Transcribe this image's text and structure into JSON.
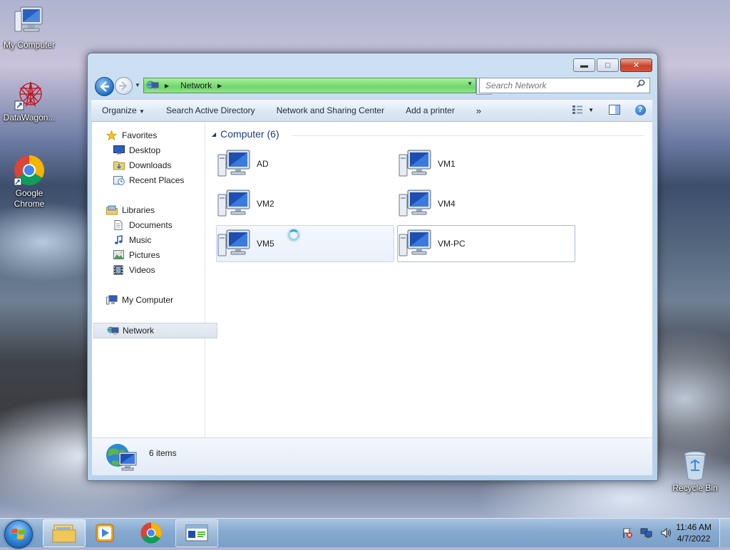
{
  "desktop": {
    "icons": [
      {
        "label": "My Computer"
      },
      {
        "label": "DataWagon..."
      },
      {
        "label": "Google Chrome"
      },
      {
        "label": "Recycle Bin"
      }
    ]
  },
  "window": {
    "address": {
      "location": "Network"
    },
    "search": {
      "placeholder": "Search Network"
    },
    "commands": [
      "Organize",
      "Search Active Directory",
      "Network and Sharing Center",
      "Add a printer"
    ],
    "more": "»",
    "nav": {
      "favorites": "Favorites",
      "desktop": "Desktop",
      "downloads": "Downloads",
      "recent": "Recent Places",
      "libraries": "Libraries",
      "documents": "Documents",
      "music": "Music",
      "pictures": "Pictures",
      "videos": "Videos",
      "computer": "My Computer",
      "network": "Network"
    },
    "group": {
      "title": "Computer (6)"
    },
    "computers": [
      "AD",
      "VM1",
      "VM2",
      "VM4",
      "VM5",
      "VM-PC"
    ],
    "status": {
      "count": "6 items"
    }
  },
  "taskbar": {
    "clock": {
      "time": "11:46 AM",
      "date": "4/7/2022"
    }
  },
  "colors": {
    "address_green": "#6fd66a",
    "group_header": "#1e3f7a",
    "accent_blue": "#1f6fc0"
  }
}
